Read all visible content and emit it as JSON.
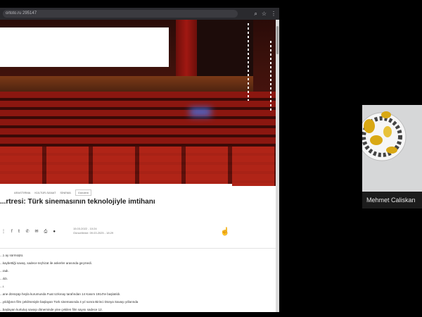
{
  "browser": {
    "url": "ortoto.ru 295147",
    "toolbar_icons": [
      "search-icon",
      "star-icon",
      "menu-icon"
    ]
  },
  "article": {
    "breadcrumb": [
      "ARASTIRMA",
      "KÜLTÜR-SANAT",
      "SİNEMA"
    ],
    "tag": "Gündem",
    "title": "...rtresi: Türk sinemasının teknolojiyle imtihanı",
    "published": "15.03.2022 - 10:24",
    "updated": "Güncelleme: 09.03.2025 - 18:29",
    "share_icons": [
      "share-icon",
      "facebook-icon",
      "twitter-icon",
      "whatsapp-icon",
      "email-icon",
      "print-icon",
      "bookmark-icon"
    ],
    "body_lines": [
      "...1 ay sürmüştü.",
      "...kaybettiği savaş, sadece teçhizat ile askerler arasında geçmedi.",
      "...radı.",
      "...ıldı.",
      "...ı.",
      "...ane dönüşüp heyla kurumunda Fuat Uzkınay tarafından 14 Kasım 1914'te başlatıldı.",
      "...yıldığının film çekilmesiyle başlayan Türk sinemasında 4 yıl sonra Birinci Dünya Savaşı yıllarında",
      "...başlayan kurtuluş savaşı döneminde yine çekilen film sayısı sadece 12."
    ]
  },
  "participant": {
    "name": "Mehmet Caliskan"
  }
}
